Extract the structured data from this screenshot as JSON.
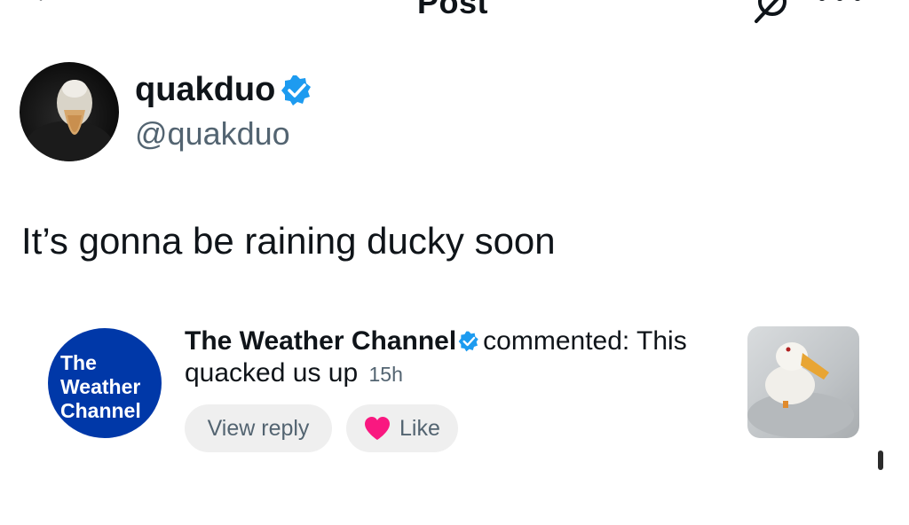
{
  "header": {
    "title": "Post",
    "back_icon": "back-arrow-icon",
    "grok_icon": "grok-icon",
    "more_icon": "more-icon"
  },
  "post": {
    "author": {
      "display_name": "quakduo",
      "handle": "@quakduo",
      "verified": true,
      "avatar": "duck-avatar"
    },
    "text": "It’s gonna be raining ducky soon"
  },
  "comment": {
    "author": "The Weather Channel",
    "verified": true,
    "action": "commented: This",
    "text": "quacked us up",
    "time": "15h",
    "avatar_text": [
      "The",
      "Weather",
      "Channel"
    ],
    "view_reply_label": "View reply",
    "like_label": "Like",
    "thumbnail": "duck-photo"
  },
  "colors": {
    "verified_blue": "#1d9bf0",
    "twc_blue": "#0038a8",
    "like_red": "#f91880",
    "secondary_text": "#536471"
  }
}
